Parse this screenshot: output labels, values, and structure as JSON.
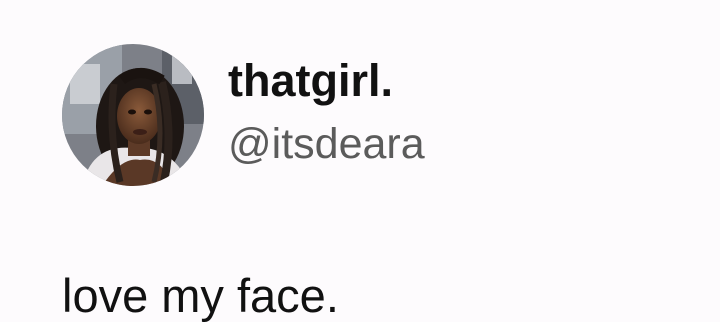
{
  "author": {
    "display_name": "thatgirl.",
    "handle": "@itsdeara",
    "avatar_icon": "profile-photo"
  },
  "post": {
    "text": "love my face."
  },
  "colors": {
    "background": "#fdfbfd",
    "name_text": "#111111",
    "handle_text": "#5b5b5b"
  }
}
